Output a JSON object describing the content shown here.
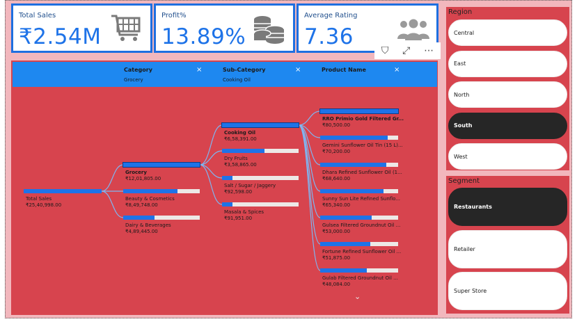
{
  "cards": [
    {
      "label": "Total Sales",
      "value": "₹2.54M",
      "icon": "shopping-cart-icon"
    },
    {
      "label": "Profit%",
      "value": "13.89%",
      "icon": "coins-icon"
    },
    {
      "label": "Average Rating",
      "value": "7.36",
      "icon": "people-group-icon"
    }
  ],
  "toolbar": {
    "filter": "⛉",
    "focus": "⤢",
    "more": "⋯"
  },
  "tree": {
    "headers": [
      {
        "title": "Category",
        "value": "Grocery"
      },
      {
        "title": "Sub-Category",
        "value": "Cooking Oil"
      },
      {
        "title": "Product Name",
        "value": ""
      }
    ],
    "close_glyph": "×",
    "more_glyph": "⌄",
    "root": {
      "label": "Total Sales",
      "value": "₹25,40,998.00",
      "fill": 1.0
    },
    "categories": [
      {
        "label": "Grocery",
        "value": "₹12,01,805.00",
        "fill": 1.0,
        "selected": true
      },
      {
        "label": "Beauty & Cosmetics",
        "value": "₹8,49,748.00",
        "fill": 0.71
      },
      {
        "label": "Dairy & Beverages",
        "value": "₹4,89,445.00",
        "fill": 0.41
      }
    ],
    "subcategories": [
      {
        "label": "Cooking Oil",
        "value": "₹6,58,391.00",
        "fill": 1.0,
        "selected": true
      },
      {
        "label": "Dry Fruits",
        "value": "₹3,58,865.00",
        "fill": 0.55
      },
      {
        "label": "Salt / Sugar / Jaggery",
        "value": "₹92,598.00",
        "fill": 0.14
      },
      {
        "label": "Masala & Spices",
        "value": "₹91,951.00",
        "fill": 0.14
      }
    ],
    "products": [
      {
        "label": "RRO Primio Gold Filtered Gr...",
        "value": "₹80,500.00",
        "fill": 1.0,
        "selected": true
      },
      {
        "label": "Gemini Sunflower Oil Tin (15 L)...",
        "value": "₹70,200.00",
        "fill": 0.87
      },
      {
        "label": "Dhara Refined Sunflower Oil (1...",
        "value": "₹68,640.00",
        "fill": 0.85
      },
      {
        "label": "Sunny Sun Lite Refined Sunflo...",
        "value": "₹65,340.00",
        "fill": 0.81
      },
      {
        "label": "Gulsea Filtered Groundnut Oil ...",
        "value": "₹53,000.00",
        "fill": 0.66
      },
      {
        "label": "Fortune Refined Sunflower Oil ...",
        "value": "₹51,875.00",
        "fill": 0.64
      },
      {
        "label": "Gulab Filtered Groundnut Oil ...",
        "value": "₹48,084.00",
        "fill": 0.6
      }
    ]
  },
  "region": {
    "title": "Region",
    "items": [
      {
        "label": "Central",
        "selected": false
      },
      {
        "label": "East",
        "selected": false
      },
      {
        "label": "North",
        "selected": false
      },
      {
        "label": "South",
        "selected": true
      },
      {
        "label": "West",
        "selected": false
      }
    ]
  },
  "segment": {
    "title": "Segment",
    "items": [
      {
        "label": "Restaurants",
        "selected": true
      },
      {
        "label": "Retailer",
        "selected": false
      },
      {
        "label": "Super Store",
        "selected": false
      }
    ]
  }
}
